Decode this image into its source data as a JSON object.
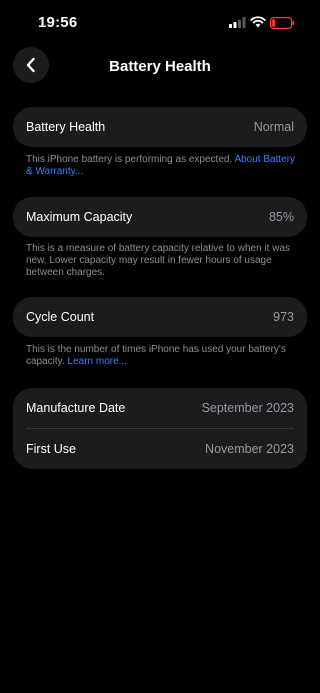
{
  "status": {
    "time": "19:56"
  },
  "nav": {
    "title": "Battery Health",
    "back_icon": "chevron-left-icon"
  },
  "battery_health": {
    "label": "Battery Health",
    "value": "Normal",
    "footnote": "This iPhone battery is performing as expected.",
    "footnote_link": "About Battery & Warranty..."
  },
  "maximum_capacity": {
    "label": "Maximum Capacity",
    "value": "85%",
    "footnote": "This is a measure of battery capacity relative to when it was new. Lower capacity may result in fewer hours of usage between charges."
  },
  "cycle_count": {
    "label": "Cycle Count",
    "value": "973",
    "footnote": "This is the number of times iPhone has used your battery's capacity.",
    "footnote_link": "Learn more..."
  },
  "dates": {
    "manufacture_label": "Manufacture Date",
    "manufacture_value": "September 2023",
    "first_use_label": "First Use",
    "first_use_value": "November 2023"
  },
  "colors": {
    "accent": "#3a82f7",
    "battery_low": "#ff3b30"
  }
}
